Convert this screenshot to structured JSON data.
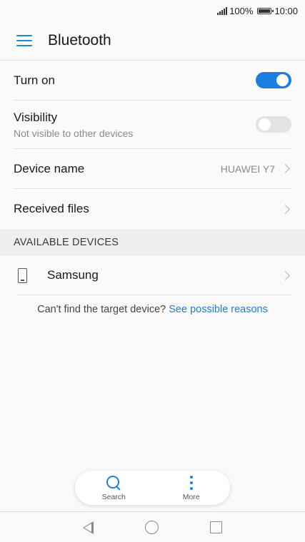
{
  "status_bar": {
    "battery_percent": "100%",
    "time": "10:00"
  },
  "header": {
    "title": "Bluetooth"
  },
  "settings": {
    "turn_on": {
      "label": "Turn on",
      "enabled": true
    },
    "visibility": {
      "label": "Visibility",
      "subtitle": "Not visible to other devices",
      "enabled": false
    },
    "device_name": {
      "label": "Device name",
      "value": "HUAWEI Y7"
    },
    "received_files": {
      "label": "Received files"
    }
  },
  "available_devices": {
    "header": "AVAILABLE DEVICES",
    "devices": [
      {
        "name": "Samsung",
        "icon": "phone-icon"
      }
    ]
  },
  "hint": {
    "text": "Can't find the target device?",
    "link": "See possible reasons"
  },
  "actions": {
    "search_label": "Search",
    "more_label": "More"
  },
  "colors": {
    "accent": "#1a7fe0",
    "toggle_off": "#e3e3e3"
  }
}
